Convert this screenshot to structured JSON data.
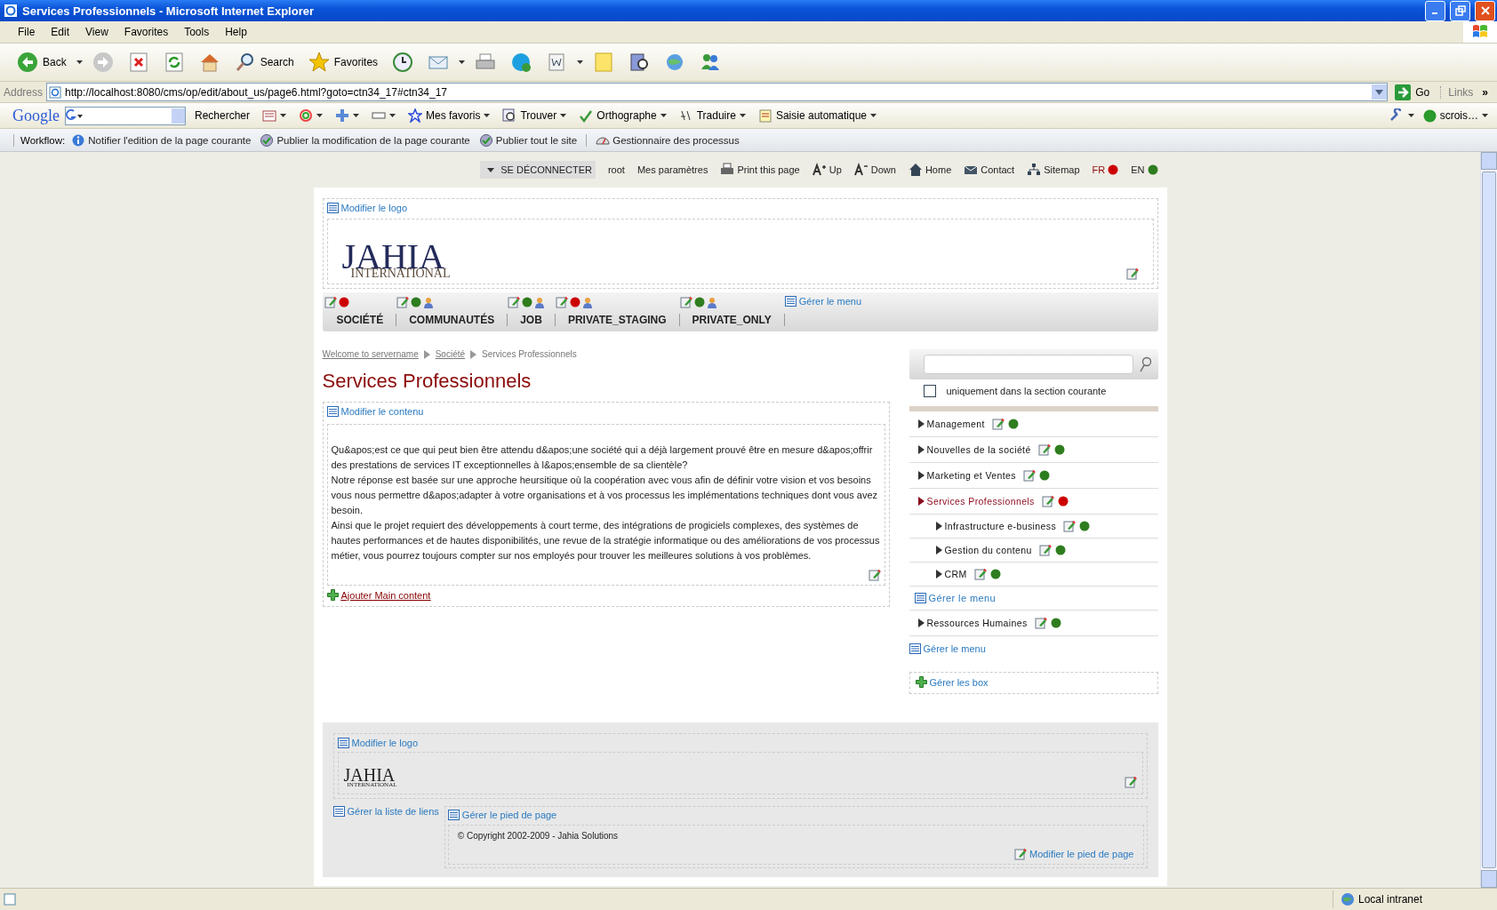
{
  "window": {
    "title": "Services Professionnels - Microsoft Internet Explorer"
  },
  "menu_bar": [
    "File",
    "Edit",
    "View",
    "Favorites",
    "Tools",
    "Help"
  ],
  "toolbar": [
    {
      "kind": "back",
      "label": "Back"
    },
    {
      "kind": "forward"
    },
    {
      "kind": "stop"
    },
    {
      "kind": "refresh"
    },
    {
      "kind": "home"
    },
    {
      "kind": "search",
      "label": "Search"
    },
    {
      "kind": "favorites",
      "label": "Favorites"
    },
    {
      "kind": "history"
    },
    {
      "kind": "mail"
    },
    {
      "kind": "print"
    },
    {
      "kind": "phone"
    },
    {
      "kind": "word"
    },
    {
      "kind": "note"
    },
    {
      "kind": "research"
    },
    {
      "kind": "globe"
    },
    {
      "kind": "messenger"
    }
  ],
  "address": {
    "label": "Address",
    "value": "http://localhost:8080/cms/op/edit/about_us/page6.html?goto=ctn34_17#ctn34_17",
    "go": "Go",
    "links": "Links",
    "more": "»"
  },
  "google_bar": {
    "logo": "Google",
    "search_button": "Rechercher",
    "items": [
      {
        "kind": "news"
      },
      {
        "kind": "pagerank"
      },
      {
        "kind": "plus"
      },
      {
        "kind": "box"
      },
      {
        "kind": "star",
        "label": "Mes favoris"
      },
      {
        "kind": "find",
        "label": "Trouver"
      },
      {
        "kind": "spell",
        "label": "Orthographe"
      },
      {
        "kind": "translate",
        "label": "Traduire"
      },
      {
        "kind": "autofill",
        "label": "Saisie automatique"
      }
    ],
    "account": "scrois…"
  },
  "workflow": {
    "label": "Workflow:",
    "items": [
      {
        "kind": "info",
        "label": "Notifier l'edition de la page courante"
      },
      {
        "kind": "publish",
        "label": "Publier la modification de la page courante"
      },
      {
        "kind": "publish",
        "label": "Publier tout le site"
      },
      {
        "kind": "gauge",
        "label": "Gestionnaire des processus"
      }
    ]
  },
  "utility_bar": {
    "items": [
      {
        "kind": "logout",
        "label": "SE DÉCONNECTER"
      },
      {
        "kind": "text",
        "label": "root"
      },
      {
        "kind": "text",
        "label": "Mes paramètres"
      },
      {
        "kind": "print",
        "label": "Print this page"
      },
      {
        "kind": "font_up",
        "label": "Up"
      },
      {
        "kind": "font_down",
        "label": "Down"
      },
      {
        "kind": "home",
        "label": "Home"
      },
      {
        "kind": "mail",
        "label": "Contact"
      },
      {
        "kind": "sitemap",
        "label": "Sitemap"
      }
    ],
    "languages": [
      {
        "code": "FR",
        "selected": true,
        "color": "#cc0000"
      },
      {
        "code": "EN",
        "selected": false,
        "color": "#2e7d1e"
      }
    ]
  },
  "header": {
    "logo_edit": "Modifier le logo",
    "logo_name": "JAHIA",
    "logo_sub": "INTERNATIONAL"
  },
  "top_menu": {
    "manage": "Gérer le menu",
    "items": [
      {
        "label": "SOCIÉTÉ",
        "color": "#cc0000",
        "shared": false
      },
      {
        "label": "COMMUNAUTÉS",
        "color": "#2e7d1e",
        "shared": true
      },
      {
        "label": "JOB",
        "color": "#2e7d1e",
        "shared": true
      },
      {
        "label": "PRIVATE_STAGING",
        "color": "#cc0000",
        "shared": true
      },
      {
        "label": "PRIVATE_ONLY",
        "color": "#2e7d1e",
        "shared": true
      }
    ]
  },
  "breadcrumb": [
    {
      "kind": "link",
      "label": "Welcome to servername"
    },
    {
      "kind": "link",
      "label": "Société"
    },
    {
      "kind": "current",
      "label": "Services Professionnels"
    }
  ],
  "page_title": "Services Professionnels",
  "content": {
    "edit_label": "Modifier le contenu",
    "paragraphs": [
      "Qu&apos;est ce que qui peut bien être attendu d&apos;une société qui a déjà largement prouvé être en mesure d&apos;offrir des prestations de services IT exceptionnelles à l&apos;ensemble de sa clientèle?",
      "Notre réponse est basée sur une approche heursitique où la coopération avec vous afin de définir votre vision et vos besoins vous nous permettre d&apos;adapter à votre organisations et à vos processus les implémentations techniques dont vous avez besoin.",
      "Ainsi que le projet requiert des développements à court terme, des intégrations de progiciels complexes, des systèmes de hautes performances et de hautes disponibilités, une revue de la stratégie informatique ou des améliorations de vos processus métier, vous pourrez toujours compter sur nos employés pour trouver les meilleures solutions à vos problèmes."
    ],
    "add_label": "Ajouter Main content"
  },
  "search": {
    "checkbox": {
      "label": "uniquement dans la section courante",
      "checked": false
    }
  },
  "nav": {
    "items": [
      {
        "label": "Management",
        "color": "#2e7d1e",
        "selected": false
      },
      {
        "label": "Nouvelles de la société",
        "color": "#2e7d1e",
        "selected": false
      },
      {
        "label": "Marketing et Ventes",
        "color": "#2e7d1e",
        "selected": false
      },
      {
        "label": "Services Professionnels",
        "color": "#cc0000",
        "selected": true,
        "manage": "Gérer le menu",
        "children": [
          {
            "label": "Infrastructure e-business",
            "color": "#2e7d1e",
            "selected": false
          },
          {
            "label": "Gestion du contenu",
            "color": "#2e7d1e",
            "selected": false
          },
          {
            "label": "CRM",
            "color": "#2e7d1e",
            "selected": false
          }
        ]
      },
      {
        "label": "Ressources Humaines",
        "color": "#2e7d1e",
        "selected": false
      }
    ],
    "manage": "Gérer le menu",
    "boxes": "Gérer les box"
  },
  "footer": {
    "logo_edit": "Modifier le logo",
    "logo_name": "JAHIA",
    "logo_sub": "INTERNATIONAL",
    "links_manage": "Gérer la liste de liens",
    "footer_manage": "Gérer le pied de page",
    "copyright": "© Copyright 2002-2009 - Jahia Solutions",
    "footer_edit": "Modifier le pied de page"
  },
  "status_bar": {
    "zone": "Local intranet"
  }
}
